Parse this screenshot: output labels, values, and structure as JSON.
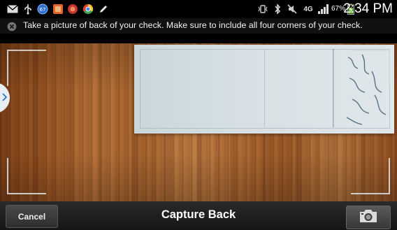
{
  "status_bar": {
    "time": "2:34 PM",
    "battery_percent": "67%",
    "network_label": "4G",
    "left_icons": [
      "mail-icon",
      "usb-icon",
      "notification-67-icon",
      "app-icon",
      "app-icon-2",
      "chrome-icon",
      "pen-icon"
    ],
    "right_icons": [
      "vibrate-icon",
      "bluetooth-icon",
      "mute-icon",
      "network-4g-icon",
      "signal-icon",
      "battery-icon"
    ]
  },
  "banner": {
    "icon": "close-circle-icon",
    "text": "Take a picture of back of your check. Make sure to include all four corners of your check."
  },
  "bottom_bar": {
    "cancel_label": "Cancel",
    "title": "Capture Back",
    "capture_icon": "camera-icon"
  },
  "colors": {
    "status_bar_bg": "#000000",
    "banner_bg": "#111111",
    "bottom_bar_bg": "#1f1f1f",
    "wood": "#a7652f",
    "check": "#d6e0e3"
  }
}
